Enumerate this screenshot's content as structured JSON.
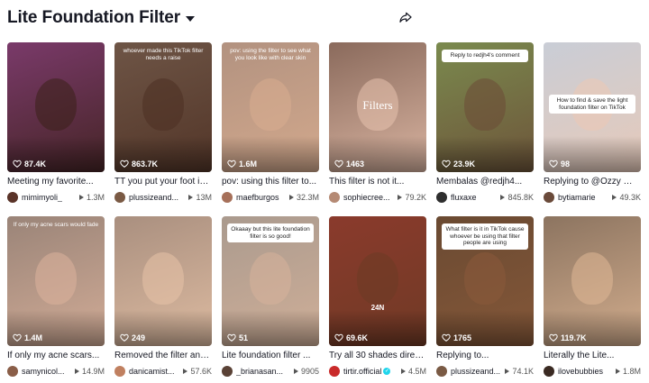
{
  "header": {
    "title": "Lite Foundation Filter",
    "caret_icon": "chevron-down-icon",
    "share_icon": "share-icon"
  },
  "videos": [
    {
      "views": "87.4K",
      "desc": "Meeting my favorite...",
      "author": "mimimyoli_",
      "plays": "1.3M",
      "overlay": "",
      "color": "#7a3a6a",
      "face": "#3b2018",
      "avatar": "#5a3328"
    },
    {
      "views": "863.7K",
      "desc": "TT you put your foot in...",
      "author": "plussizeand...",
      "plays": "13M",
      "overlay": "whoever made this TikTok filter needs a raise",
      "color": "#6e5546",
      "face": "#4d2f22",
      "avatar": "#7a5a44"
    },
    {
      "views": "1.6M",
      "desc": "pov: using this filter to...",
      "author": "maefburgos",
      "plays": "32.3M",
      "overlay": "pov: using the filter to see what you look like with clear skin",
      "color": "#b29280",
      "face": "#d9ad8f",
      "avatar": "#a6705a"
    },
    {
      "views": "1463",
      "desc": "This filter is not it...",
      "author": "sophiecree...",
      "plays": "79.2K",
      "overlay": "Filters",
      "color": "#8a6a5c",
      "face": "#e8c2ae",
      "avatar": "#b58a74"
    },
    {
      "views": "23.9K",
      "desc": "Membalas @redjh4...",
      "author": "fluxaxe",
      "plays": "845.8K",
      "overlay": "Reply to redjh4's comment",
      "color": "#7a8a4e",
      "face": "#6b4a36",
      "avatar": "#2e2e2e"
    },
    {
      "views": "98",
      "desc": "Replying to @Ozzy 🐝...",
      "author": "bytiamarie",
      "plays": "49.3K",
      "overlay": "How to find & save the light foundation filter on TikTok",
      "color": "#c9cdd6",
      "face": "#ecc9b4",
      "avatar": "#6a4a3a"
    },
    {
      "views": "1.4M",
      "desc": "If only my acne scars...",
      "author": "samynicol...",
      "plays": "14.9M",
      "overlay": "If only my acne scars would fade",
      "color": "#9a8478",
      "face": "#dcb39c",
      "avatar": "#8a5e48"
    },
    {
      "views": "249",
      "desc": "Removed the filter and...",
      "author": "danicamist...",
      "plays": "57.6K",
      "overlay": "",
      "color": "#a98f7f",
      "face": "#e7c3a7",
      "avatar": "#c08060"
    },
    {
      "views": "51",
      "desc": "Lite foundation filter ...",
      "author": "_brianasan...",
      "plays": "9905",
      "overlay": "Okaaay but this lite foundation filter is so good!",
      "color": "#aa9a8e",
      "face": "#d7b39a",
      "avatar": "#5a4236"
    },
    {
      "views": "69.6K",
      "desc": "Try all 30 shades direct...",
      "author": "tirtir.official",
      "plays": "4.5M",
      "overlay": "24N",
      "color": "#8a3a2c",
      "face": "#6b3a24",
      "avatar": "#c92a2a",
      "verified": true
    },
    {
      "views": "1765",
      "desc": "Replying to...",
      "author": "plussizeand...",
      "plays": "74.1K",
      "overlay": "What filter is it in TikTok cause whoever be using that filter people are using",
      "color": "#6a4a32",
      "face": "#8a5a3a",
      "avatar": "#7a5a44"
    },
    {
      "views": "119.7K",
      "desc": "Literally the Lite...",
      "author": "ilovebubbies",
      "plays": "1.8M",
      "overlay": "",
      "color": "#8c7460",
      "face": "#e0b896",
      "avatar": "#3a2a22"
    }
  ],
  "icons": {
    "views": "heart-outline-icon",
    "plays": "play-icon"
  }
}
